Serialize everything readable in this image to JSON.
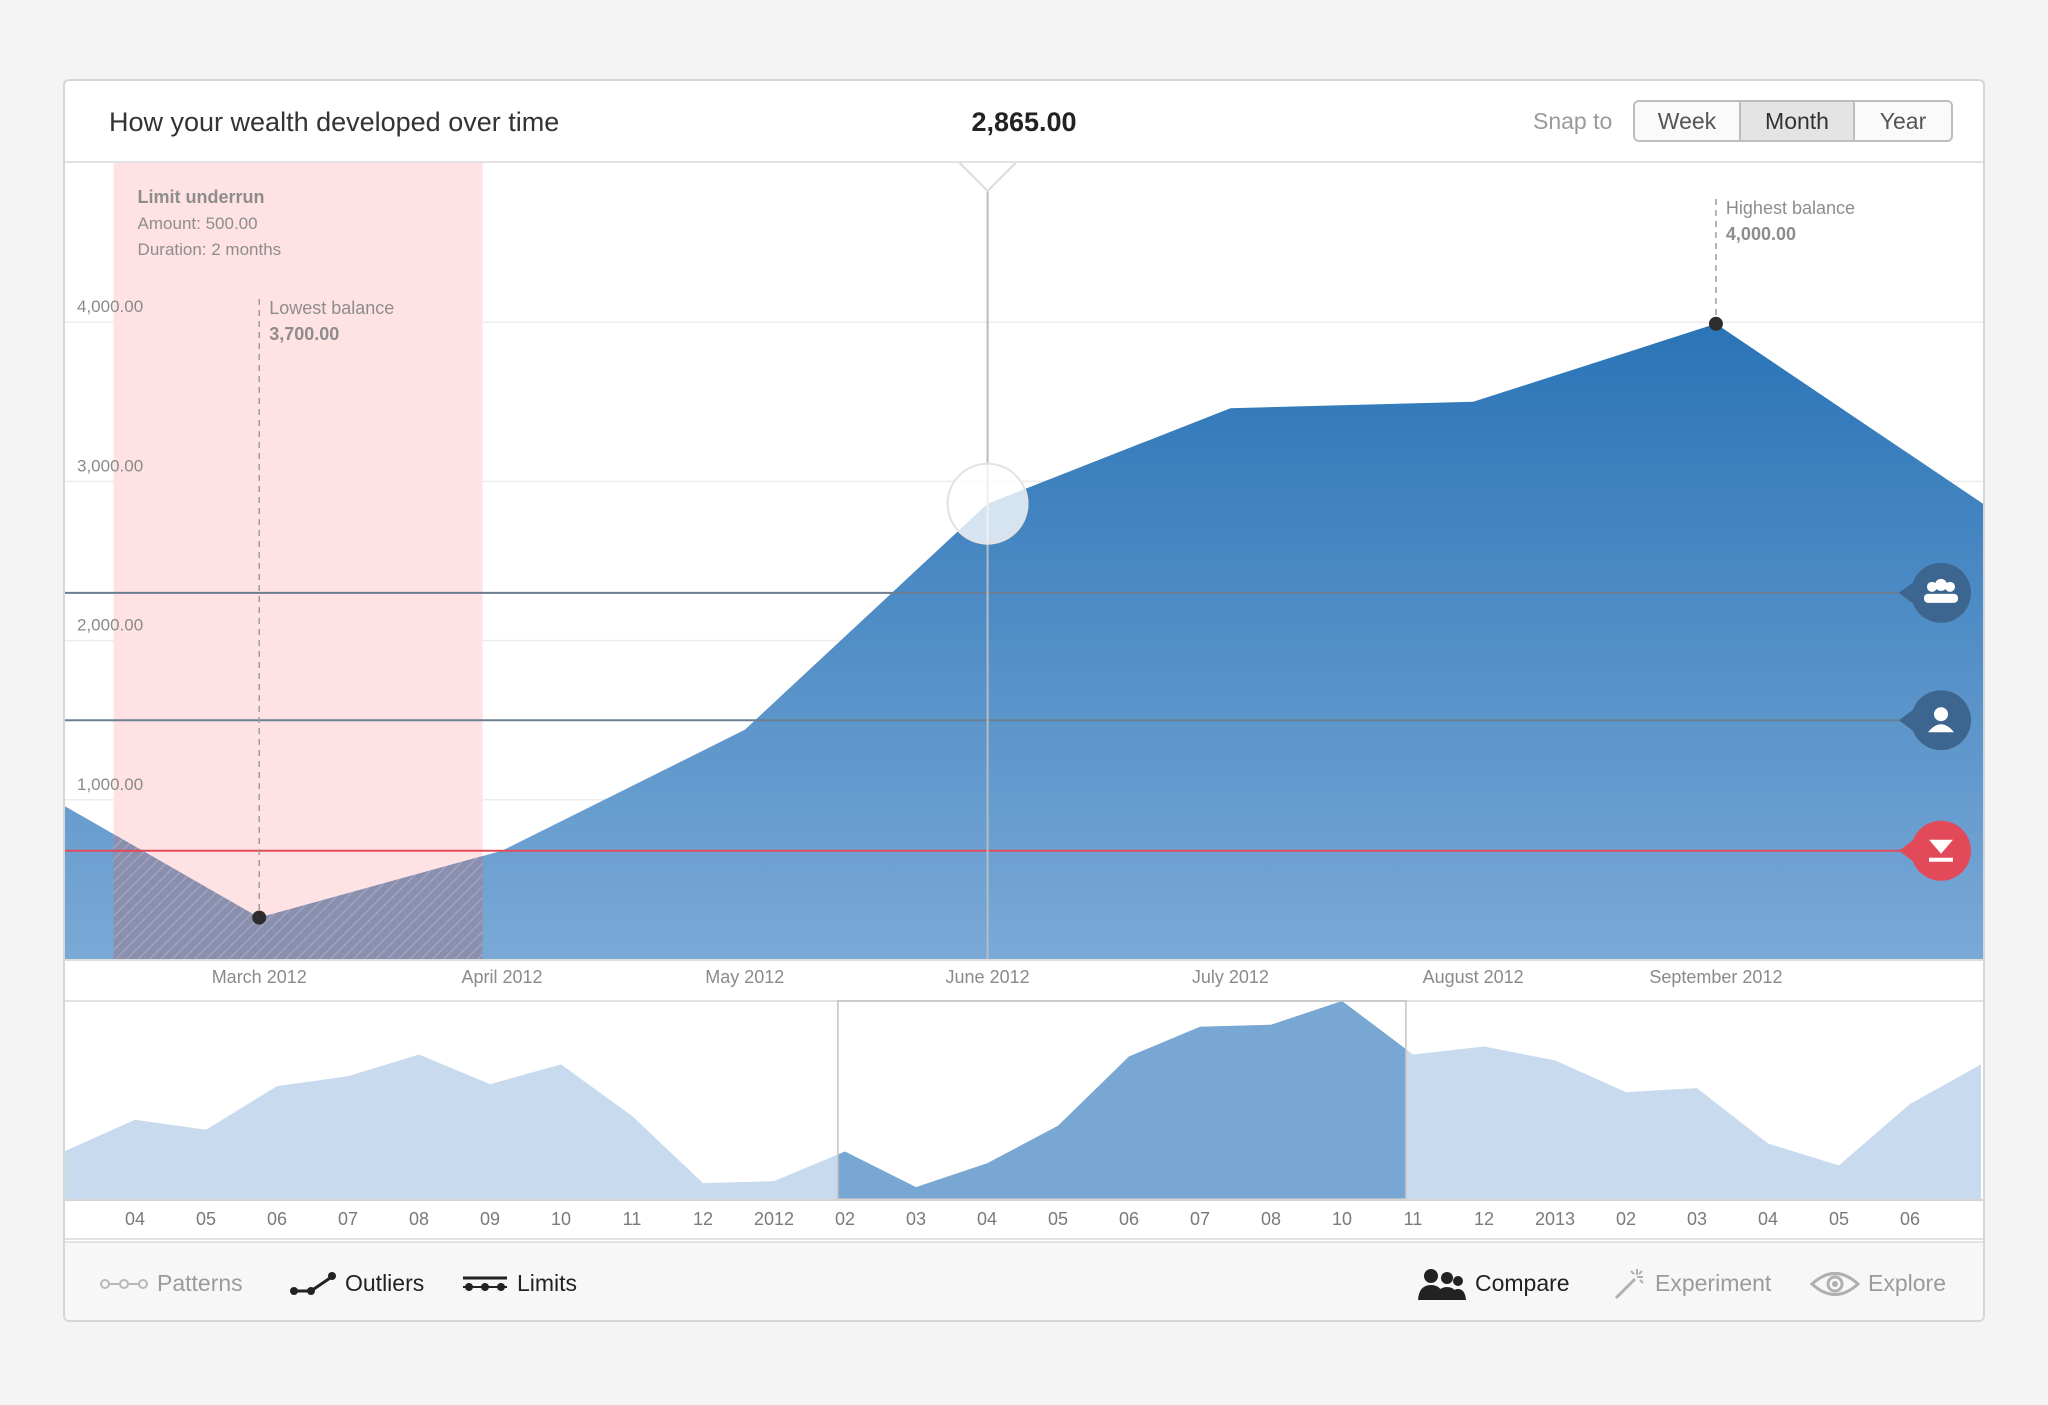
{
  "header": {
    "title": "How your wealth developed over time",
    "current_value": "2,865.00",
    "snap_label": "Snap to",
    "snap_options": [
      "Week",
      "Month",
      "Year"
    ],
    "snap_selected": "Month"
  },
  "colors": {
    "area_top": "#2a74b7",
    "area_bottom": "#7aa9d6",
    "limit_band": "#ffe2e4",
    "limit_line": "#e24a5a",
    "overview_fill": "#c8dbee",
    "overview_selected": "#78a7d3"
  },
  "annotations": {
    "limit_underrun": {
      "title": "Limit underrun",
      "amount": "Amount: 500.00",
      "duration": "Duration: 2 months"
    },
    "lowest": {
      "label": "Lowest balance",
      "value": "3,700.00"
    },
    "highest": {
      "label": "Highest balance",
      "value": "4,000.00"
    }
  },
  "chart_data": {
    "type": "area",
    "y_ticks": [
      {
        "value": 1000,
        "label": "1,000.00"
      },
      {
        "value": 2000,
        "label": "2,000.00"
      },
      {
        "value": 3000,
        "label": "3,000.00"
      },
      {
        "value": 4000,
        "label": "4,000.00"
      }
    ],
    "ylim": [
      0,
      5000
    ],
    "x_labels": [
      "March 2012",
      "April 2012",
      "May 2012",
      "June 2012",
      "July 2012",
      "August 2012",
      "September 2012"
    ],
    "xlim": [
      -0.8,
      7.1
    ],
    "series": [
      {
        "points": [
          {
            "x": -0.8,
            "y": 960
          },
          {
            "x": 0,
            "y": 260
          },
          {
            "x": 1,
            "y": 680
          },
          {
            "x": 2,
            "y": 1440
          },
          {
            "x": 3,
            "y": 2860
          },
          {
            "x": 4,
            "y": 3460
          },
          {
            "x": 5,
            "y": 3500
          },
          {
            "x": 6,
            "y": 3990
          },
          {
            "x": 7.1,
            "y": 2860
          }
        ]
      }
    ],
    "limit_underrun_range": [
      -0.6,
      0.92
    ],
    "limit_value": 680,
    "reference_lines": [
      {
        "value": 2300,
        "icon": "group-icon"
      },
      {
        "value": 1500,
        "icon": "person-icon"
      },
      {
        "value": 680,
        "icon": "limit-icon"
      }
    ],
    "cursor_x": 3,
    "lowest_point": {
      "x": 0,
      "y": 260
    },
    "highest_point": {
      "x": 6,
      "y": 3990
    },
    "overview": {
      "ticks": [
        "04",
        "05",
        "06",
        "07",
        "08",
        "09",
        "10",
        "11",
        "12",
        "2012",
        "02",
        "03",
        "04",
        "05",
        "06",
        "07",
        "08",
        "10",
        "11",
        "12",
        "2013",
        "02",
        "03",
        "04",
        "05",
        "06"
      ],
      "values": [
        0.24,
        0.4,
        0.35,
        0.57,
        0.62,
        0.73,
        0.58,
        0.68,
        0.42,
        0.08,
        0.09,
        0.24,
        0.06,
        0.18,
        0.37,
        0.72,
        0.87,
        0.88,
        1.0,
        0.73,
        0.77,
        0.7,
        0.54,
        0.56,
        0.28,
        0.17,
        0.48,
        0.68
      ],
      "selected_range": [
        10.9,
        18.9
      ]
    }
  },
  "footer": {
    "left_tools": [
      {
        "label": "Patterns",
        "icon": "patterns-icon",
        "active": false
      },
      {
        "label": "Outliers",
        "icon": "outliers-icon",
        "active": true
      },
      {
        "label": "Limits",
        "icon": "limits-icon",
        "active": true
      }
    ],
    "right_tools": [
      {
        "label": "Compare",
        "icon": "compare-icon",
        "active": true
      },
      {
        "label": "Experiment",
        "icon": "experiment-icon",
        "active": false
      },
      {
        "label": "Explore",
        "icon": "explore-icon",
        "active": false
      }
    ]
  }
}
